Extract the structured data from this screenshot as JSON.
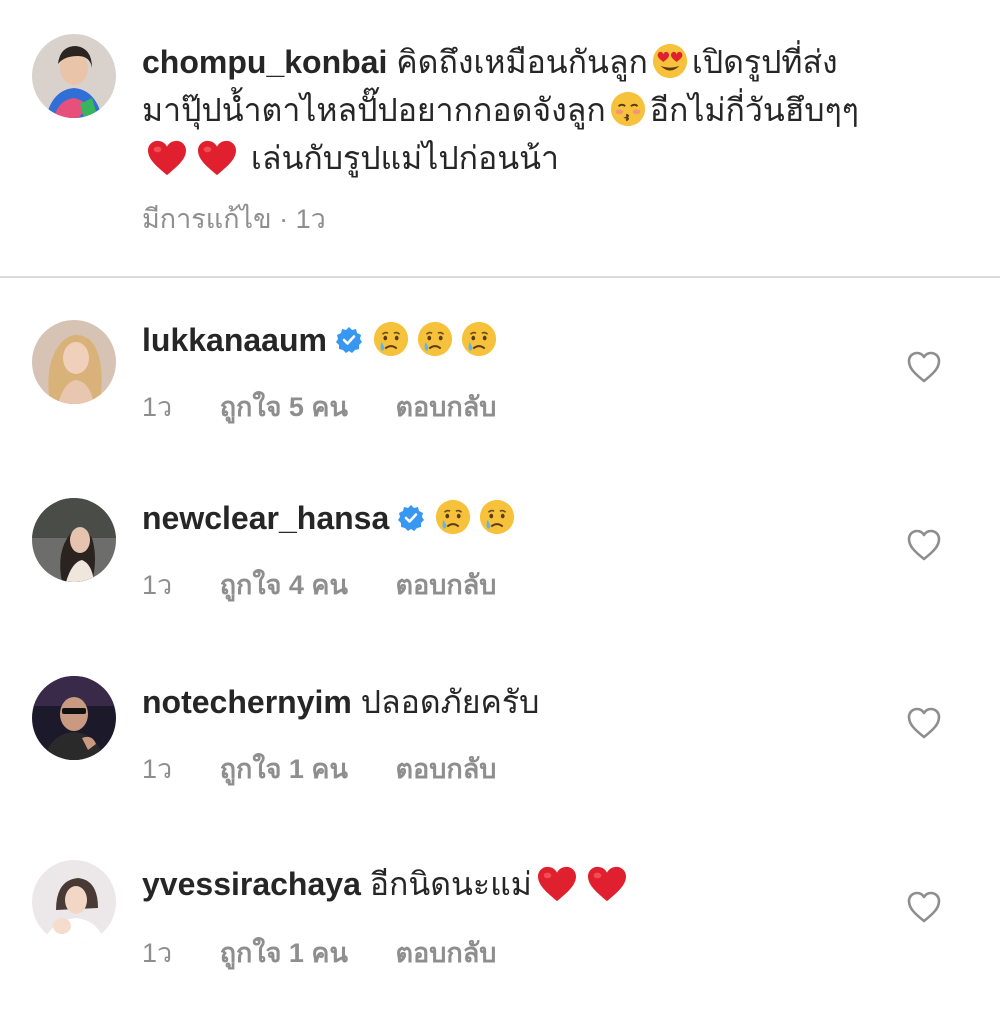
{
  "post_caption": {
    "username": "chompu_konbai",
    "text_1": "คิดถึงเหมือนกันลูก",
    "text_2": "เปิดรูปที่ส่ง",
    "text_3": "มาปุ๊ปน้ำตาไหลปั๊ปอยากกอดจังลูก",
    "text_4": "อีกไม่กี่วันฮึบๆๆ",
    "text_5": "เล่นกับรูปแม่ไปก่อนน้า",
    "edited_label": "มีการแก้ไข · 1ว"
  },
  "comments": [
    {
      "username": "lukkanaaum",
      "verified": true,
      "text": "",
      "emojis": [
        "crying-face",
        "crying-face",
        "crying-face"
      ],
      "time": "1ว",
      "likes_label": "ถูกใจ 5 คน",
      "reply_label": "ตอบกลับ"
    },
    {
      "username": "newclear_hansa",
      "verified": true,
      "text": "",
      "emojis": [
        "crying-face",
        "crying-face"
      ],
      "time": "1ว",
      "likes_label": "ถูกใจ 4 คน",
      "reply_label": "ตอบกลับ"
    },
    {
      "username": "notechernyim",
      "verified": false,
      "text": "ปลอดภัยครับ",
      "time": "1ว",
      "likes_label": "ถูกใจ 1 คน",
      "reply_label": "ตอบกลับ"
    },
    {
      "username": "yvessirachaya",
      "verified": false,
      "text": "อีกนิดนะแม่",
      "emojis": [
        "red-heart",
        "red-heart"
      ],
      "time": "1ว",
      "likes_label": "ถูกใจ 1 คน",
      "reply_label": "ตอบกลับ"
    }
  ],
  "colors": {
    "text_primary": "#262626",
    "text_secondary": "#8e8e8e",
    "verified_blue": "#3897f0",
    "heart_red": "#e0202e",
    "divider": "#dbdbdb"
  }
}
